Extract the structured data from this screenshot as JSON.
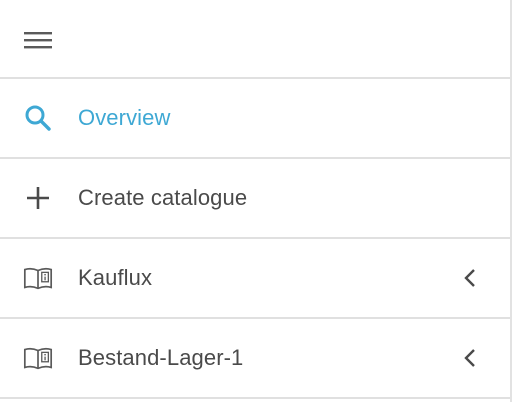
{
  "colors": {
    "accent": "#3ea8d4",
    "text": "#4a4a4a",
    "divider": "#e0e0e0"
  },
  "menu": {
    "toggle_icon": "hamburger-menu-icon",
    "items": [
      {
        "label": "Overview",
        "icon": "search-icon",
        "active": true
      },
      {
        "label": "Create catalogue",
        "icon": "plus-icon",
        "active": false
      },
      {
        "label": "Kauflux",
        "icon": "catalog-book-icon",
        "expand_icon": "chevron-left-icon",
        "active": false
      },
      {
        "label": "Bestand-Lager-1",
        "icon": "catalog-book-icon",
        "expand_icon": "chevron-left-icon",
        "active": false
      }
    ]
  }
}
